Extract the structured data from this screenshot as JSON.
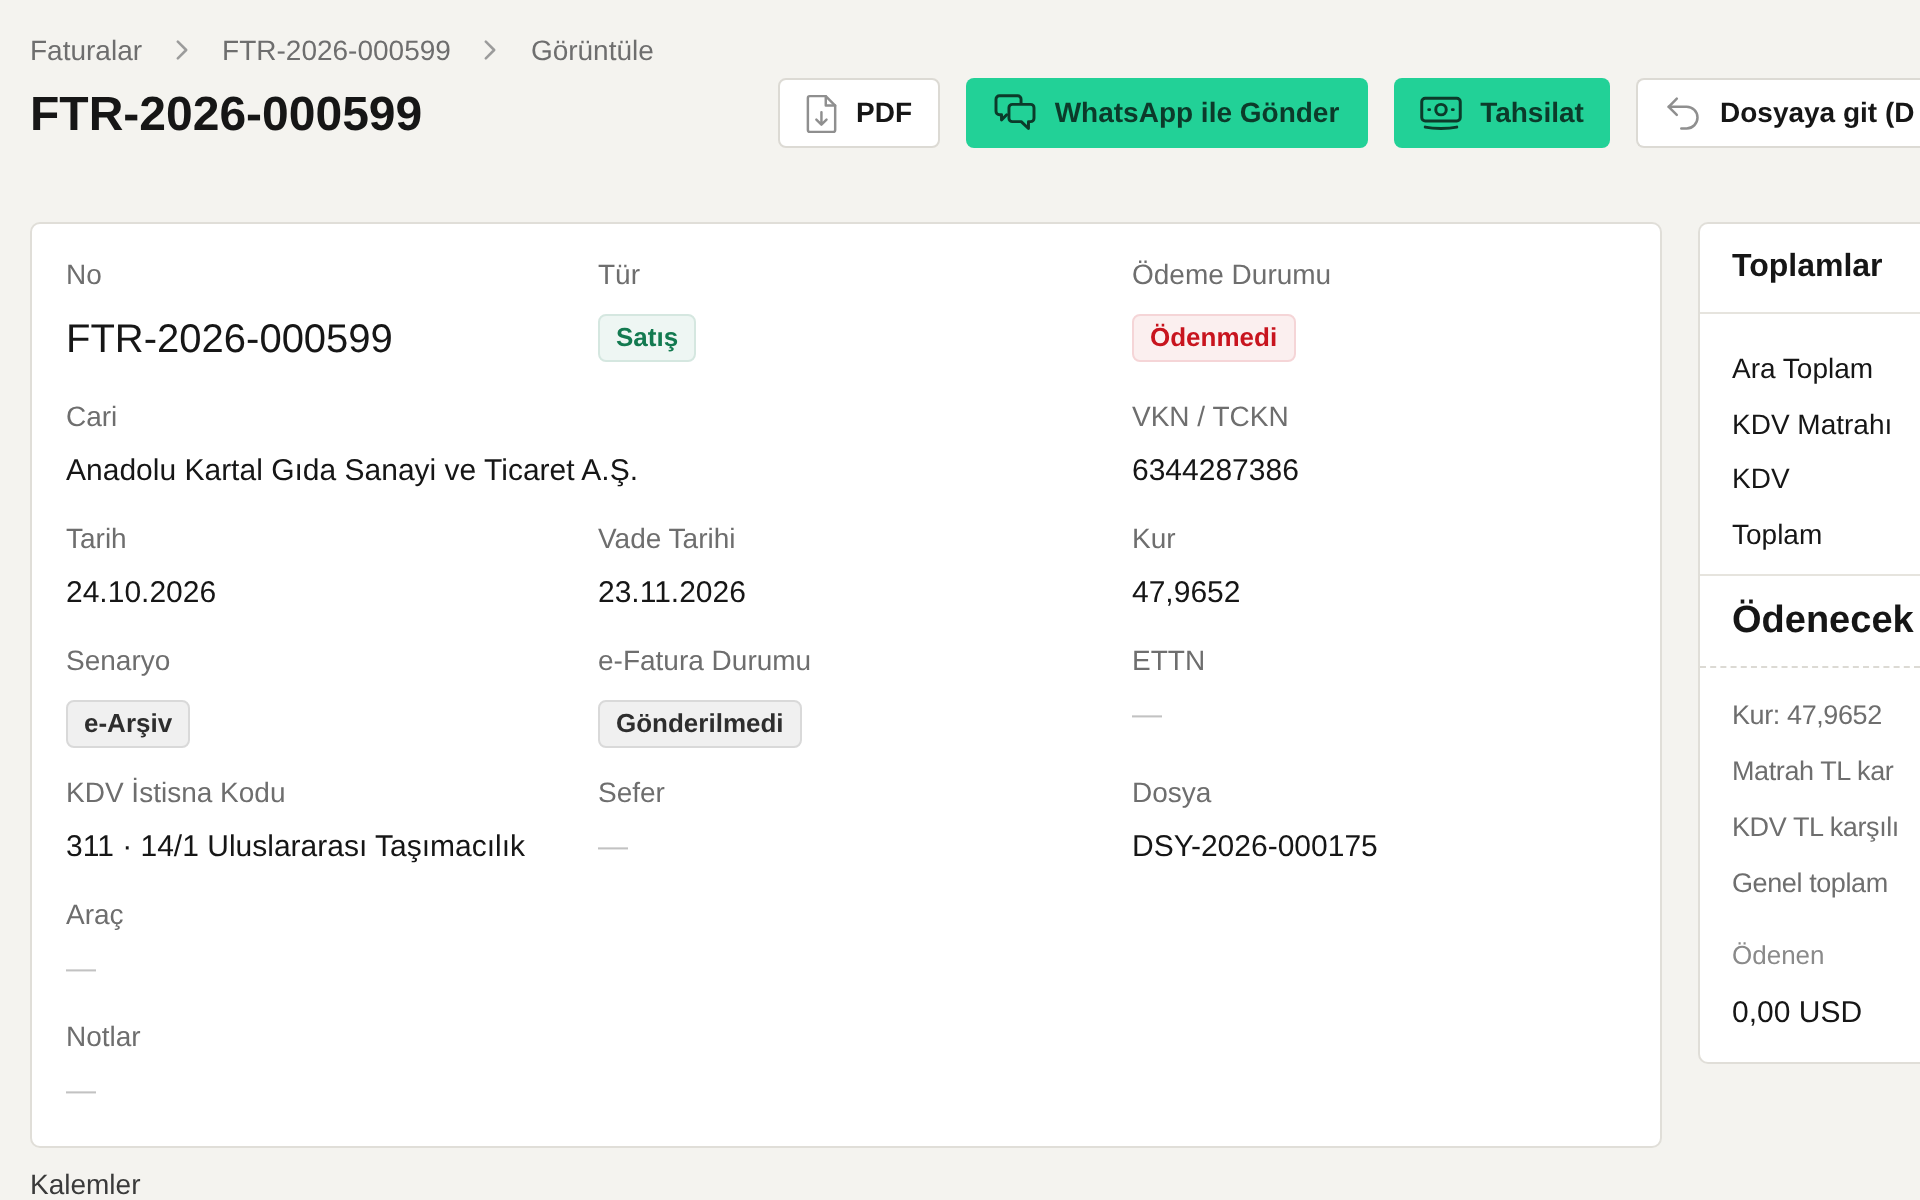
{
  "breadcrumb": [
    {
      "label": "Faturalar"
    },
    {
      "label": "FTR-2026-000599"
    },
    {
      "label": "Görüntüle"
    }
  ],
  "title": "FTR-2026-000599",
  "actions": [
    {
      "label": "PDF",
      "primary": false
    },
    {
      "label": "WhatsApp ile Gönder",
      "primary": true
    },
    {
      "label": "Tahsilat",
      "primary": true
    },
    {
      "label": "Dosyaya git (D",
      "primary": false
    }
  ],
  "details": {
    "rows": [
      [
        {
          "label": "No",
          "kind": "heading",
          "value": "FTR-2026-000599"
        },
        {
          "label": "Tür",
          "kind": "badge",
          "value": "Satış",
          "color": "#137a50"
        },
        {
          "label": "Ödeme Durumu",
          "kind": "badge",
          "value": "Ödenmedi",
          "color": "#c8141e"
        }
      ],
      [
        {
          "label": "Cari",
          "kind": "text",
          "value": "Anadolu Kartal Gıda Sanayi ve Ticaret A.Ş."
        },
        "",
        {
          "label": "VKN / TCKN",
          "kind": "text",
          "value": "6344287386"
        }
      ],
      [
        {
          "label": "Tarih",
          "kind": "text",
          "value": "24.10.2026"
        },
        {
          "label": "Vade Tarihi",
          "kind": "text",
          "value": "23.11.2026"
        },
        {
          "label": "Kur",
          "kind": "text",
          "value": "47,9652"
        }
      ],
      [
        {
          "label": "Senaryo",
          "kind": "badge",
          "value": "e-Arşiv",
          "color": "#2e2e2e"
        },
        {
          "label": "e-Fatura Durumu",
          "kind": "badge",
          "value": "Gönderilmedi",
          "color": "#2e2e2e"
        },
        {
          "label": "ETTN",
          "kind": "empty",
          "value": "—"
        }
      ],
      [
        {
          "label": "KDV İstisna Kodu",
          "kind": "text",
          "value": "311 · 14/1 Uluslararası Taşımacılık"
        },
        {
          "label": "Sefer",
          "kind": "empty",
          "value": "—"
        },
        {
          "label": "Dosya",
          "kind": "text",
          "value": "DSY-2026-000175"
        }
      ],
      [
        {
          "label": "Araç",
          "kind": "empty",
          "value": "—"
        }
      ],
      [
        {
          "label": "Notlar",
          "kind": "empty",
          "value": "—"
        }
      ]
    ]
  },
  "totals": {
    "title": "Toplamlar",
    "rows": [
      "Ara Toplam",
      "KDV Matrahı",
      "KDV",
      "Toplam"
    ],
    "due_label": "Ödenecek",
    "tl_rows": [
      "Kur: 47,9652",
      "Matrah TL kar",
      "KDV TL karşılı",
      "Genel toplam"
    ],
    "paid_label": "Ödenen",
    "paid_value": "0,00 USD"
  },
  "section_title": "Kalemler"
}
